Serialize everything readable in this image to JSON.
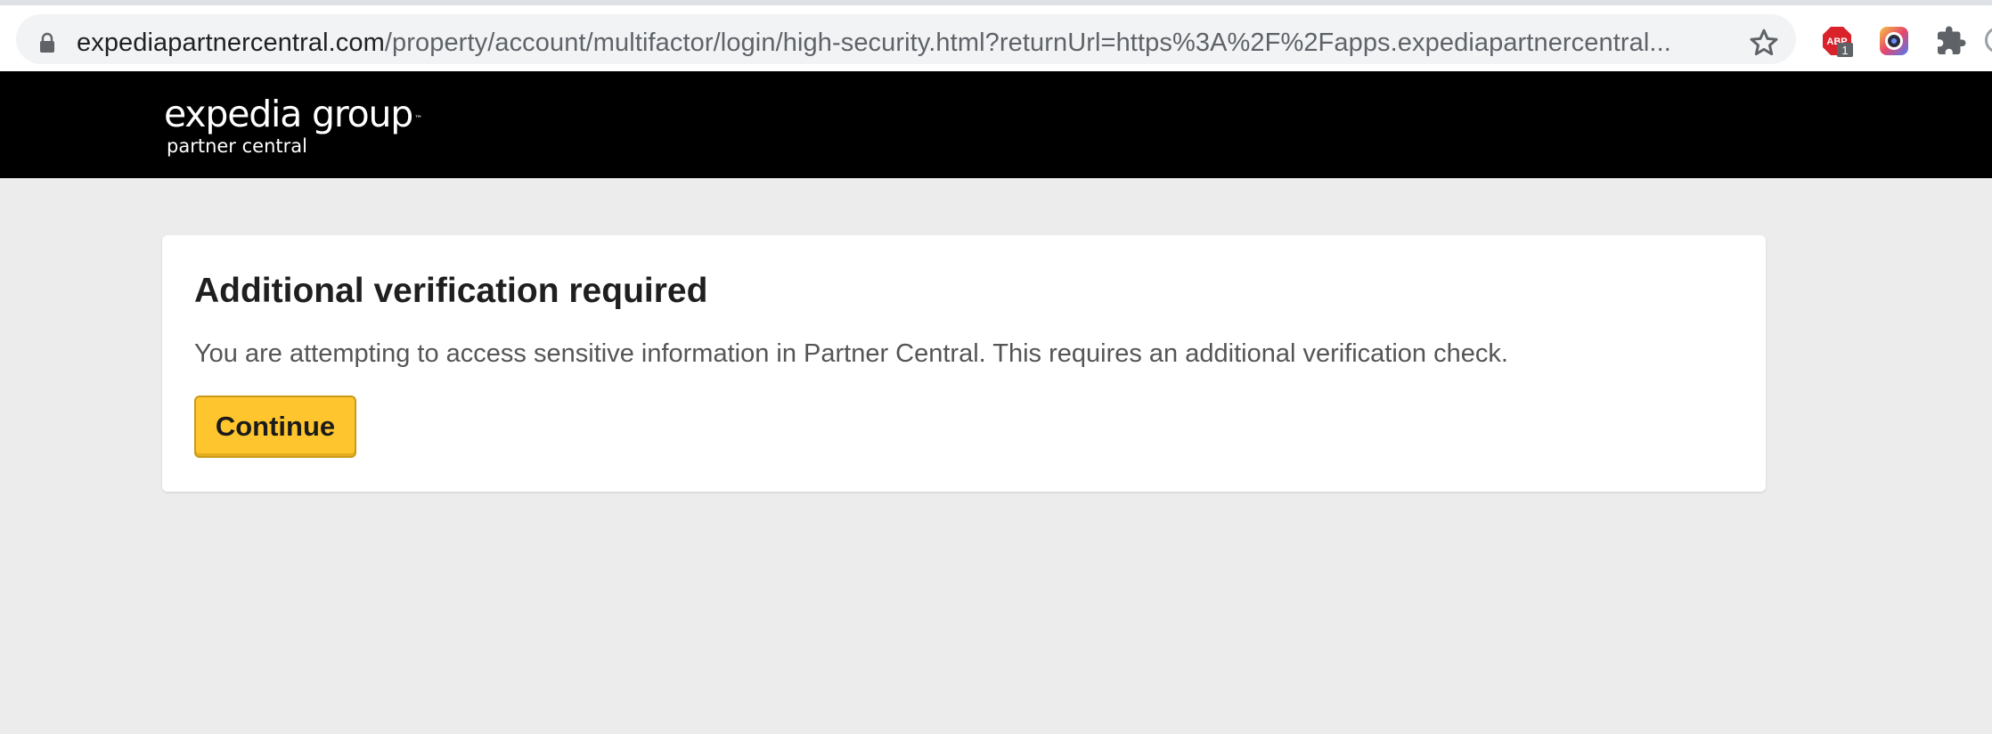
{
  "browser": {
    "url_host": "expediapartnercentral.com",
    "url_path": "/property/account/multifactor/login/high-security.html?returnUrl=https%3A%2F%2Fapps.expediapartnercentral...",
    "extensions": [
      {
        "name": "adblock-plus",
        "badge_text": "ABP",
        "count": "1"
      },
      {
        "name": "camera-extension"
      },
      {
        "name": "extensions-menu"
      }
    ]
  },
  "header": {
    "logo_main": "expedia group",
    "logo_tm": "™",
    "logo_sub": "partner central",
    "background": "#000000"
  },
  "card": {
    "title": "Additional verification required",
    "message": "You are attempting to access sensitive information in Partner Central. This requires an additional verification check.",
    "continue_label": "Continue",
    "button_color": "#fec52e"
  }
}
